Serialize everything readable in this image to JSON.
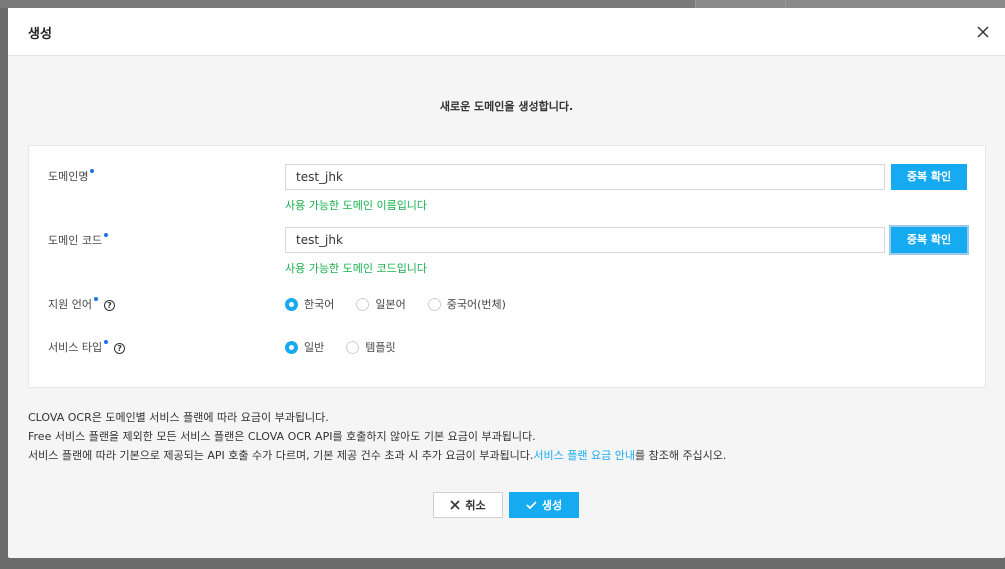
{
  "modal": {
    "title": "생성",
    "intro": "새로운 도메인을 생성합니다."
  },
  "form": {
    "domain_name": {
      "label": "도메인명",
      "value": "test_jhk",
      "check_label": "중복 확인",
      "message": "사용 가능한 도메인 이름입니다"
    },
    "domain_code": {
      "label": "도메인 코드",
      "value": "test_jhk",
      "check_label": "중복 확인",
      "message": "사용 가능한 도메인 코드입니다"
    },
    "language": {
      "label": "지원 언어",
      "options": [
        "한국어",
        "일본어",
        "중국어(번체)"
      ],
      "selected": "한국어"
    },
    "service_type": {
      "label": "서비스 타입",
      "options": [
        "일반",
        "템플릿"
      ],
      "selected": "일반"
    }
  },
  "notes": {
    "line1": "CLOVA OCR은 도메인별 서비스 플랜에 따라 요금이 부과됩니다.",
    "line2": "Free 서비스 플랜을 제외한 모든 서비스 플랜은 CLOVA OCR API를 호출하지 않아도 기본 요금이 부과됩니다.",
    "line3_prefix": "서비스 플랜에 따라 기본으로 제공되는 API 호출 수가 다르며, 기본 제공 건수 초과 시 추가 요금이 부과됩니다.",
    "line3_link": "서비스 플랜 요금 안내",
    "line3_suffix": "를 참조해 주십시오."
  },
  "footer": {
    "cancel_label": "취소",
    "create_label": "생성"
  },
  "colors": {
    "accent": "#16aaf0",
    "success": "#17b14d",
    "required_dot": "#1a73e8"
  },
  "icons": {
    "close": "close-icon",
    "help": "help-icon",
    "cancel": "x-icon",
    "create": "check-icon"
  }
}
